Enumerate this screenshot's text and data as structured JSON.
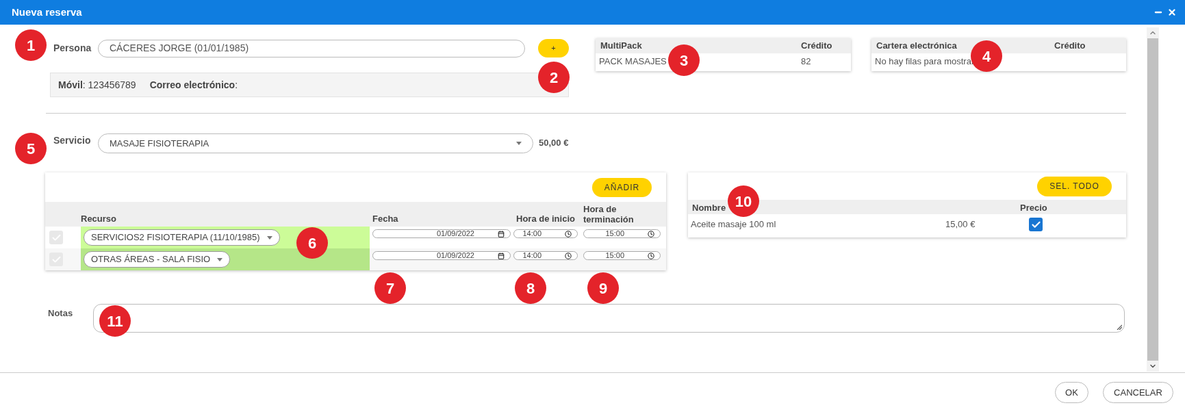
{
  "window": {
    "title": "Nueva reserva"
  },
  "persona": {
    "label": "Persona",
    "value": "CÁCERES JORGE (01/01/1985)",
    "add_button": "+"
  },
  "contact": [
    "**Móvil**: 123456789",
    "**Correo electrónico**:"
  ],
  "multipack": {
    "columns": [
      "MultiPack",
      "Crédito"
    ],
    "rows": [
      [
        "PACK MASAJES",
        "82"
      ]
    ]
  },
  "wallet": {
    "columns": [
      "Cartera electrónica",
      "Crédito"
    ],
    "empty_text": "No hay filas para mostrar"
  },
  "service": {
    "label": "Servicio",
    "value": "MASAJE FISIOTERAPIA",
    "price": "50,00 €"
  },
  "resources": {
    "add_button": "AÑADIR",
    "columns": [
      "Recurso",
      "Fecha",
      "Hora de inicio",
      "Hora de terminación"
    ],
    "rows": [
      {
        "checked": true,
        "color": "#ccfc98",
        "resource": "SERVICIOS2 FISIOTERAPIA (11/10/1985)",
        "date": "01/09/2022",
        "start": "14:00",
        "end": "15:00"
      },
      {
        "checked": true,
        "color": "#b5e688",
        "resource": "OTRAS ÁREAS - SALA FISIO",
        "date": "01/09/2022",
        "start": "14:00",
        "end": "15:00"
      }
    ]
  },
  "products": {
    "select_all_button": "SEL. TODO",
    "columns": [
      "Nombre",
      "Precio"
    ],
    "rows": [
      {
        "name": "Aceite masaje 100 ml",
        "price": "15,00 €",
        "checked": true
      }
    ]
  },
  "notes": {
    "label": "Notas"
  },
  "buttons": [
    "OK",
    "CANCELAR"
  ],
  "callouts": [
    "1",
    "2",
    "3",
    "4",
    "5",
    "6",
    "7",
    "8",
    "9",
    "10",
    "11"
  ]
}
